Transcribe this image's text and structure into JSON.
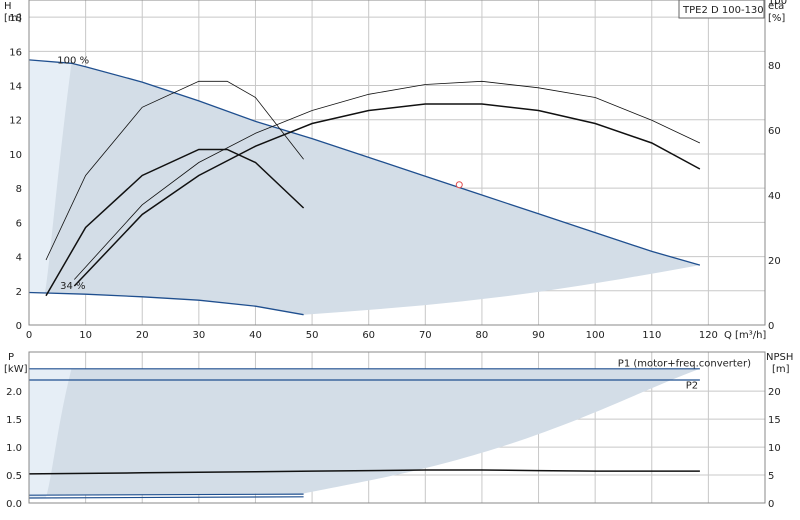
{
  "chart_data": [
    {
      "type": "line",
      "model_label": "TPE2 D 100-130",
      "ylabel": "H",
      "ylabel_unit": "[m]",
      "y2label": "eta",
      "y2label_unit": "[%]",
      "xlabel": "Q [m³/h]",
      "xlim": [
        0,
        130
      ],
      "ylim": [
        0,
        19
      ],
      "y2lim": [
        0,
        100
      ],
      "x_ticks": [
        0,
        10,
        20,
        30,
        40,
        50,
        60,
        70,
        80,
        90,
        100,
        110,
        120
      ],
      "x_tick_labels": [
        "0",
        "10",
        "20",
        "30",
        "40",
        "50",
        "60",
        "70",
        "80",
        "90",
        "100",
        "110",
        "120"
      ],
      "y_ticks": [
        0,
        2,
        4,
        6,
        8,
        10,
        12,
        14,
        16,
        18
      ],
      "y2_ticks": [
        0,
        20,
        40,
        60,
        80,
        100
      ],
      "grid": true,
      "colors": {
        "range_fill": "#d3dde7",
        "low_flow_fill": "#e6eef6",
        "curve_blue": "#1f4f8f",
        "curve_black": "#111111",
        "grid": "#c8c8c8",
        "duty_point": "#e05050"
      },
      "curve_labels": [
        {
          "text": "100 %",
          "x": 5,
          "y": 15.3
        },
        {
          "text": "34 %",
          "x": 5.5,
          "y": 2.1
        }
      ],
      "series": [
        {
          "role": "H_max",
          "axis": "H",
          "x": [
            0,
            7.5,
            10,
            20,
            30,
            40,
            50,
            60,
            70,
            80,
            90,
            100,
            110,
            118.5
          ],
          "y": [
            15.5,
            15.3,
            15.1,
            14.2,
            13.1,
            11.9,
            10.9,
            9.8,
            8.7,
            7.6,
            6.5,
            5.4,
            4.3,
            3.5
          ]
        },
        {
          "role": "H_min",
          "axis": "H",
          "x": [
            0,
            10,
            20,
            30,
            40,
            48.5
          ],
          "y": [
            1.9,
            1.8,
            1.65,
            1.45,
            1.1,
            0.6
          ]
        },
        {
          "role": "eta_max_thin",
          "axis": "eta",
          "x": [
            8,
            20,
            30,
            40,
            50,
            60,
            70,
            80,
            90,
            100,
            110,
            118.5
          ],
          "y": [
            14,
            37,
            50,
            59,
            66,
            71,
            74,
            75,
            73,
            70,
            63,
            56
          ]
        },
        {
          "role": "eta_max",
          "axis": "eta",
          "x": [
            8,
            20,
            30,
            40,
            50,
            60,
            70,
            80,
            90,
            100,
            110,
            118.5
          ],
          "y": [
            12,
            34,
            46,
            55,
            62,
            66,
            68,
            68,
            66,
            62,
            56,
            48
          ]
        },
        {
          "role": "eta_min_thin",
          "axis": "eta",
          "x": [
            3,
            10,
            20,
            30,
            35,
            40,
            48.5
          ],
          "y": [
            20,
            46,
            67,
            75,
            75,
            70,
            51
          ]
        },
        {
          "role": "eta_min",
          "axis": "eta",
          "x": [
            3,
            10,
            20,
            30,
            35,
            40,
            48.5
          ],
          "y": [
            9,
            30,
            46,
            54,
            54,
            50,
            36
          ]
        }
      ],
      "duty_point": {
        "x": 76,
        "y": 8.2
      }
    },
    {
      "type": "line",
      "ylabel": "P",
      "ylabel_unit": "[kW]",
      "y2label": "NPSH",
      "y2label_unit": "[m]",
      "xlim": [
        0,
        130
      ],
      "ylim": [
        0,
        2.7
      ],
      "y2lim": [
        0,
        27
      ],
      "y_ticks": [
        0,
        0.5,
        1.0,
        1.5,
        2.0
      ],
      "y_tick_labels": [
        "0.0",
        "0.5",
        "1.0",
        "1.5",
        "2.0"
      ],
      "y2_ticks": [
        0,
        5,
        10,
        15,
        20
      ],
      "grid": true,
      "series_labels": [
        {
          "text": "P1 (motor+freq.converter)",
          "x": 104,
          "y": 2.44
        },
        {
          "text": "P2",
          "x": 116,
          "y": 2.05
        }
      ],
      "series": [
        {
          "role": "P1_max",
          "axis": "P",
          "x": [
            0,
            118.5
          ],
          "y": [
            2.4,
            2.4
          ]
        },
        {
          "role": "P2_max",
          "axis": "P",
          "x": [
            0,
            118.5
          ],
          "y": [
            2.2,
            2.2
          ]
        },
        {
          "role": "NPSH",
          "axis": "NPSH",
          "x": [
            0,
            10,
            20,
            30,
            40,
            50,
            60,
            70,
            80,
            90,
            100,
            110,
            118.5
          ],
          "y": [
            5.2,
            5.3,
            5.4,
            5.5,
            5.6,
            5.7,
            5.8,
            5.9,
            5.9,
            5.8,
            5.7,
            5.7,
            5.7
          ]
        },
        {
          "role": "P1_min",
          "axis": "P",
          "x": [
            0,
            48.5
          ],
          "y": [
            0.14,
            0.16
          ]
        },
        {
          "role": "P2_min",
          "axis": "P",
          "x": [
            0,
            48.5
          ],
          "y": [
            0.09,
            0.11
          ]
        }
      ]
    }
  ]
}
